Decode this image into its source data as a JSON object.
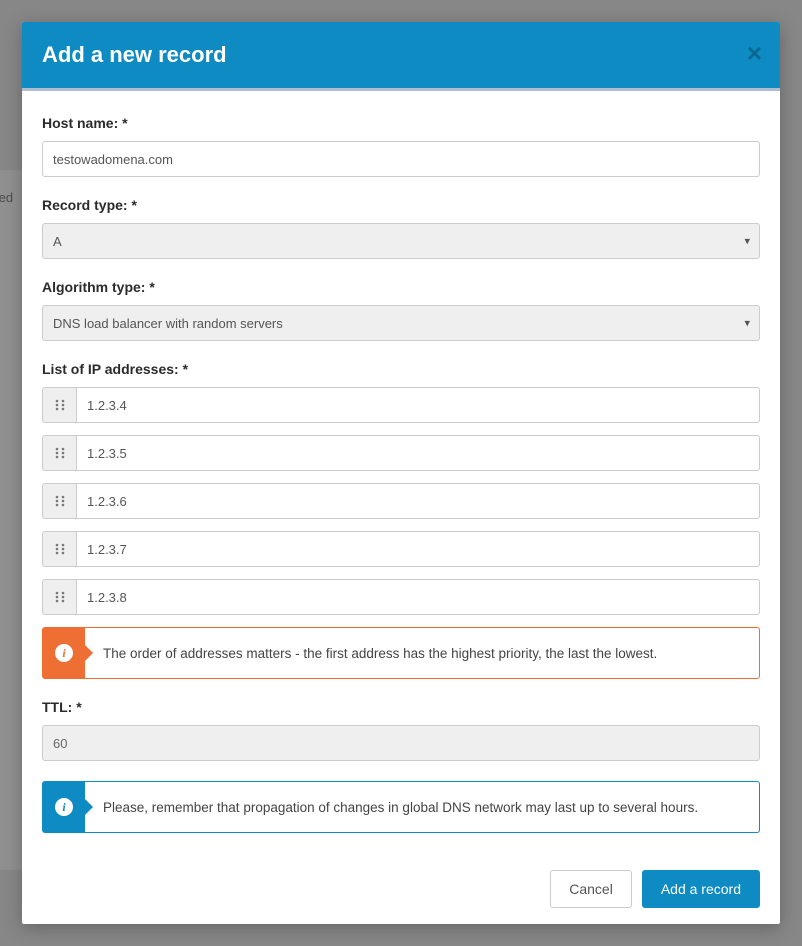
{
  "modal": {
    "title": "Add a new record",
    "labels": {
      "hostname": "Host name: *",
      "recordType": "Record type: *",
      "algorithm": "Algorithm type: *",
      "ipList": "List of IP addresses: *",
      "ttl": "TTL: *"
    },
    "values": {
      "hostname": "testowadomena.com",
      "recordType": "A",
      "algorithm": "DNS load balancer with random servers",
      "ttl": "60"
    },
    "ipAddresses": [
      "1.2.3.4",
      "1.2.3.5",
      "1.2.3.6",
      "1.2.3.7",
      "1.2.3.8"
    ],
    "alerts": {
      "order": "The order of addresses matters - the first address has the highest priority, the last the lowest.",
      "propagation": "Please, remember that propagation of changes in global DNS network may last up to several hours."
    },
    "buttons": {
      "cancel": "Cancel",
      "submit": "Add a record"
    }
  },
  "background": {
    "leftText": "fed"
  }
}
